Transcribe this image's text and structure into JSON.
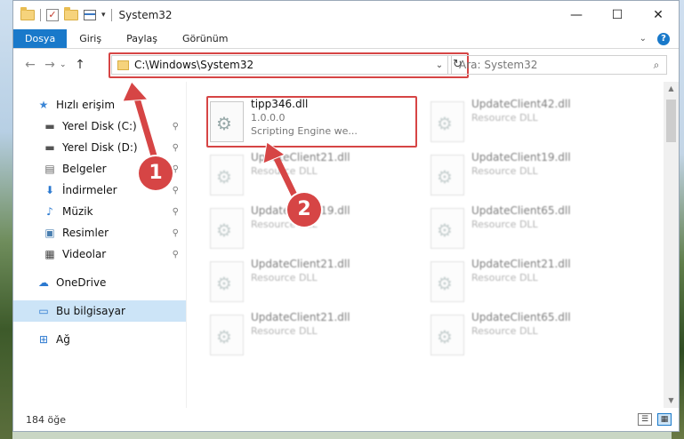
{
  "window": {
    "title": "System32",
    "minimize": "—",
    "maximize": "☐",
    "close": "✕"
  },
  "ribbon": {
    "tabs": [
      "Dosya",
      "Giriş",
      "Paylaş",
      "Görünüm"
    ],
    "expand": "⌄",
    "help": "?"
  },
  "nav": {
    "back": "←",
    "forward": "→",
    "recent": "⌄",
    "up": "↑",
    "address": "C:\\Windows\\System32",
    "address_dropdown": "⌄",
    "refresh": "↻",
    "search_placeholder": "Ara: System32",
    "search_icon": "⌕"
  },
  "sidebar": {
    "quick_access": "Hızlı erişim",
    "items": [
      {
        "label": "Yerel Disk (C:)",
        "icon": "drive-icon",
        "glyph": "▬"
      },
      {
        "label": "Yerel Disk (D:)",
        "icon": "drive-icon",
        "glyph": "▬"
      },
      {
        "label": "Belgeler",
        "icon": "documents-icon",
        "glyph": "▤"
      },
      {
        "label": "İndirmeler",
        "icon": "downloads-icon",
        "glyph": "⬇"
      },
      {
        "label": "Müzik",
        "icon": "music-icon",
        "glyph": "♪"
      },
      {
        "label": "Resimler",
        "icon": "pictures-icon",
        "glyph": "▣"
      },
      {
        "label": "Videolar",
        "icon": "videos-icon",
        "glyph": "▦"
      }
    ],
    "pin": "📌",
    "onedrive": "OneDrive",
    "this_pc": "Bu bilgisayar",
    "network": "Ağ"
  },
  "files": {
    "highlighted": {
      "name": "tipp346.dll",
      "version": "1.0.0.0",
      "description": "Scripting Engine we..."
    },
    "items": [
      {
        "name": "UpdateClient42.dll",
        "type": "Resource DLL"
      },
      {
        "name": "UpdateClient21.dll",
        "type": "Resource DLL"
      },
      {
        "name": "UpdateClient19.dll",
        "type": "Resource DLL"
      },
      {
        "name": "UpdateClient19.dll",
        "type": "Resource DLL"
      },
      {
        "name": "UpdateClient65.dll",
        "type": "Resource DLL"
      },
      {
        "name": "UpdateClient21.dll",
        "type": "Resource DLL"
      },
      {
        "name": "UpdateClient21.dll",
        "type": "Resource DLL"
      },
      {
        "name": "UpdateClient21.dll",
        "type": "Resource DLL"
      },
      {
        "name": "UpdateClient65.dll",
        "type": "Resource DLL"
      }
    ]
  },
  "status": {
    "count": "184 öğe",
    "details_view": "☰",
    "tiles_view": "▦"
  },
  "annotations": {
    "step1": "1",
    "step2": "2",
    "color": "#d64545"
  }
}
